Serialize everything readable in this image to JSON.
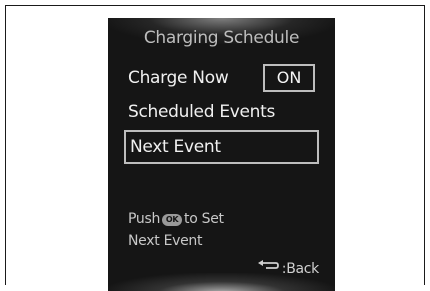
{
  "screen": {
    "title": "Charging Schedule",
    "charge_now": {
      "label": "Charge Now",
      "value": "ON"
    },
    "scheduled_events_label": "Scheduled Events",
    "next_event_label": "Next Event",
    "hint": {
      "prefix": "Push",
      "ok_button": "OK",
      "suffix": "to Set",
      "line2": "Next Event"
    },
    "back": {
      "icon": "return-arrow-icon",
      "label": ":Back"
    }
  }
}
